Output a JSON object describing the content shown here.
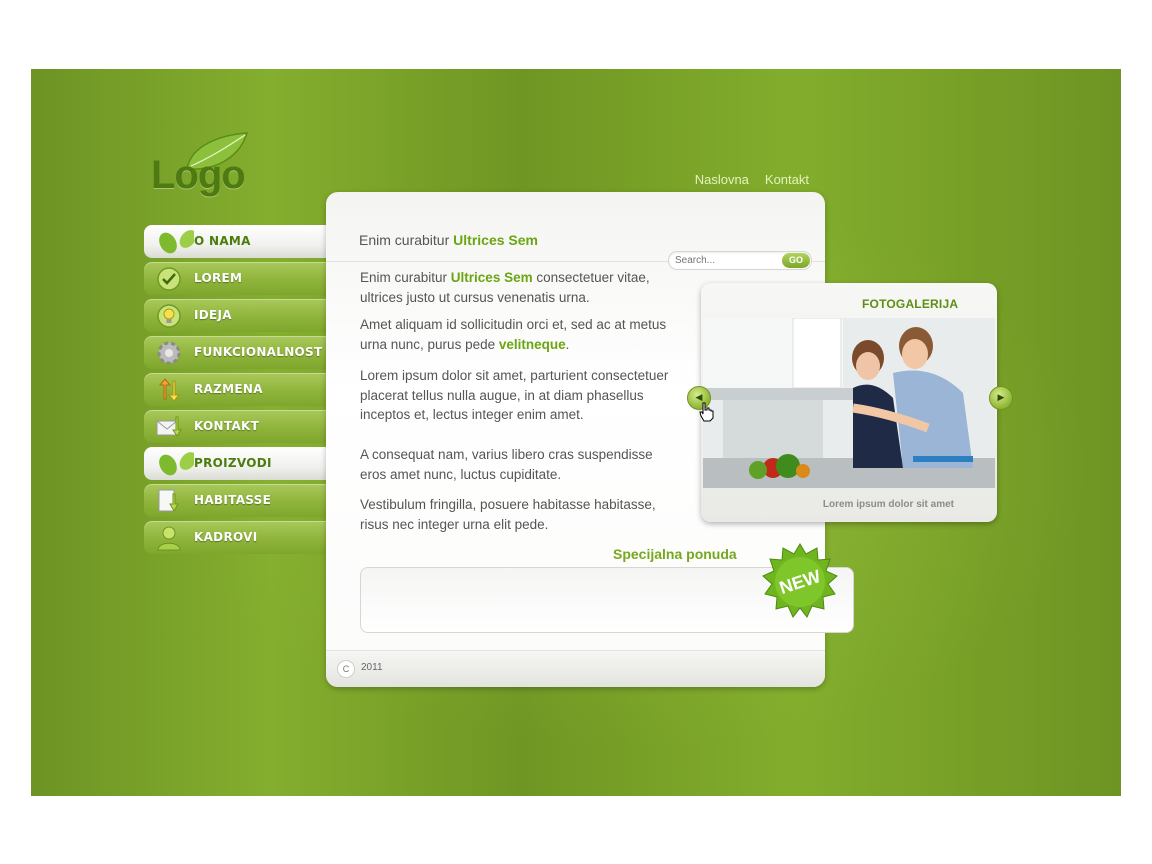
{
  "header": {
    "logo_text": "Logo",
    "links": [
      "Naslovna",
      "Kontakt"
    ]
  },
  "sidebar": {
    "items": [
      {
        "label": "O NAMA",
        "icon": "leaf-icon",
        "active": true
      },
      {
        "label": "LOREM",
        "icon": "check-icon",
        "active": false
      },
      {
        "label": "IDEJA",
        "icon": "lightbulb-icon",
        "active": false
      },
      {
        "label": "FUNKCIONALNOST",
        "icon": "gear-icon",
        "active": false
      },
      {
        "label": "RAZMENA",
        "icon": "exchange-arrows-icon",
        "active": false
      },
      {
        "label": "KONTAKT",
        "icon": "envelope-icon",
        "active": false
      },
      {
        "label": "PROIZVODI",
        "icon": "leaf-icon",
        "active": true
      },
      {
        "label": "HABITASSE",
        "icon": "download-arrow-icon",
        "active": false
      },
      {
        "label": "KADROVI",
        "icon": "user-icon",
        "active": false
      }
    ]
  },
  "main": {
    "title_prefix": "Enim curabitur ",
    "title_highlight": "Ultrices Sem",
    "search": {
      "placeholder": "Search...",
      "button": "GO"
    },
    "paragraphs": {
      "p1_pre": "Enim curabitur ",
      "p1_hl": "Ultrices Sem",
      "p1_post": " consectetuer vitae, ultrices justo ut cursus venenatis urna.",
      "p2_pre": "Amet aliquam id sollicitudin orci et, sed ac at metus urna nunc, purus pede ",
      "p2_hl": "velitneque",
      "p2_post": ".",
      "p3": "Lorem ipsum dolor sit amet, parturient consectetuer placerat tellus nulla augue, in at diam phasellus inceptos et, lectus integer enim amet.",
      "p4": "A consequat nam, varius libero cras suspendisse eros amet nunc, luctus cupiditate.",
      "p5": "Vestibulum fringilla, posuere habitasse habitasse, risus nec integer urna elit pede."
    },
    "special": {
      "title": "Specijalna ponuda",
      "badge": "NEW"
    },
    "footer": {
      "copyright_symbol": "C",
      "year": "2011"
    }
  },
  "gallery": {
    "title": "FOTOGALERIJA",
    "caption": "Lorem ipsum dolor sit amet"
  },
  "colors": {
    "background_green": "#7ea62d",
    "accent_green": "#6aa512",
    "nav_active_text": "#4a7d0e"
  }
}
